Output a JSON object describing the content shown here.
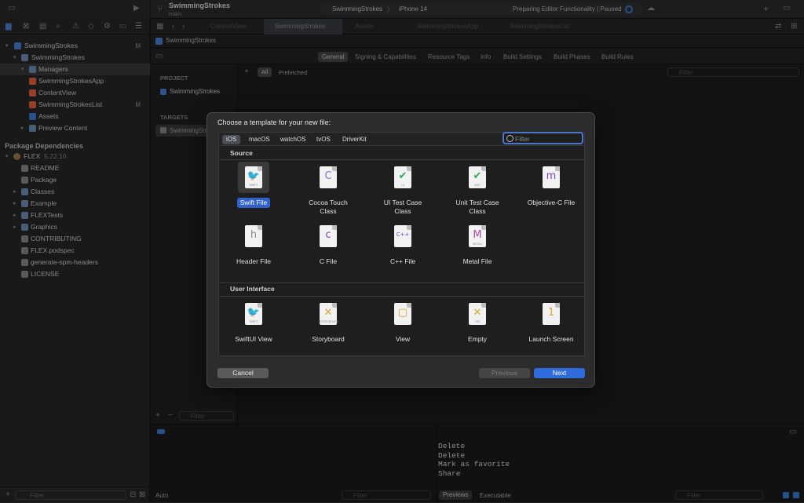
{
  "project_header": {
    "name": "SwimmingStrokes",
    "branch": "main"
  },
  "scheme": {
    "target": "SwimmingStrokes",
    "device": "iPhone 14",
    "status": "Preparing Editor Functionality | Paused"
  },
  "sidebar": {
    "items": [
      {
        "label": "SwimmingStrokes",
        "badge": "M"
      },
      {
        "label": "SwimmingStrokes",
        "badge": ""
      },
      {
        "label": "Managers",
        "badge": ""
      },
      {
        "label": "SwimmingStrokesApp",
        "badge": ""
      },
      {
        "label": "ContentView",
        "badge": ""
      },
      {
        "label": "SwimmingStrokesList",
        "badge": "M"
      },
      {
        "label": "Assets",
        "badge": ""
      },
      {
        "label": "Preview Content",
        "badge": ""
      }
    ],
    "package_section": "Package Dependencies",
    "flex": {
      "name": "FLEX",
      "version": "5.22.10"
    },
    "package_items": [
      "README",
      "Package",
      "Classes",
      "Example",
      "FLEXTests",
      "Graphics",
      "CONTRIBUTING",
      "FLEX.podspec",
      "generate-spm-headers",
      "LICENSE"
    ],
    "filter_placeholder": "Filter"
  },
  "tabs": [
    "ContentView",
    "SwimmingStrokes",
    "Assets",
    "SwimmingStrokesApp",
    "SwimmingStrokesList"
  ],
  "breadcrumb": "SwimmingStrokes",
  "editor_tabs": [
    "General",
    "Signing & Capabilities",
    "Resource Tags",
    "Info",
    "Build Settings",
    "Build Phases",
    "Build Rules"
  ],
  "filter_bar": {
    "all": "All",
    "prefetched": "Prefetched",
    "filter_placeholder": "Filter"
  },
  "project_pane": {
    "project_label": "PROJECT",
    "project": "SwimmingStrokes",
    "targets_label": "TARGETS",
    "target": "SwimmingStr",
    "filter_placeholder": "Filter"
  },
  "console_lines": [
    "Delete",
    "Delete",
    "Mark as favorite",
    "Share"
  ],
  "bottom_bar": {
    "auto": "Auto",
    "filter_placeholder": "Filter",
    "previews": "Previews",
    "executable": "Executable",
    "filter2_placeholder": "Filter"
  },
  "dialog": {
    "title": "Choose a template for your new file:",
    "platforms": [
      "iOS",
      "macOS",
      "watchOS",
      "tvOS",
      "DriverKit"
    ],
    "filter_placeholder": "Filter",
    "source_title": "Source",
    "source_items": [
      {
        "name": "Swift File",
        "name2": "",
        "icon": "swift-icon",
        "glyph": "🐦",
        "color": "#f05138",
        "sub": "SWIFT"
      },
      {
        "name": "Cocoa Touch",
        "name2": "Class",
        "icon": "cocoa-class-icon",
        "glyph": "C",
        "color": "#8a6fc5",
        "sub": ""
      },
      {
        "name": "UI Test Case",
        "name2": "Class",
        "icon": "ui-test-icon",
        "glyph": "✔",
        "color": "#2fa84f",
        "sub": "UI"
      },
      {
        "name": "Unit Test Case",
        "name2": "Class",
        "icon": "unit-test-icon",
        "glyph": "✔",
        "color": "#2fa84f",
        "sub": "UNIT"
      },
      {
        "name": "Objective-C File",
        "name2": "",
        "icon": "objc-icon",
        "glyph": "m",
        "color": "#7b45c8",
        "sub": ""
      },
      {
        "name": "Header File",
        "name2": "",
        "icon": "header-icon",
        "glyph": "h",
        "color": "#8a8a8a",
        "sub": ""
      },
      {
        "name": "C File",
        "name2": "",
        "icon": "c-file-icon",
        "glyph": "c",
        "color": "#7b45c8",
        "sub": ""
      },
      {
        "name": "C++ File",
        "name2": "",
        "icon": "cpp-file-icon",
        "glyph": "C++",
        "color": "#7b45c8",
        "sub": ""
      },
      {
        "name": "Metal File",
        "name2": "",
        "icon": "metal-icon",
        "glyph": "M",
        "color": "#b04a9a",
        "sub": "METAL"
      }
    ],
    "ui_title": "User Interface",
    "ui_items": [
      {
        "name": "SwiftUI View",
        "icon": "swiftui-icon",
        "glyph": "🐦",
        "color": "#f05138",
        "sub": "SWIFT"
      },
      {
        "name": "Storyboard",
        "icon": "storyboard-icon",
        "glyph": "✕",
        "color": "#e0a32c",
        "sub": "STORYBOARD"
      },
      {
        "name": "View",
        "icon": "view-icon",
        "glyph": "▢",
        "color": "#e0a32c",
        "sub": ""
      },
      {
        "name": "Empty",
        "icon": "empty-icon",
        "glyph": "✕",
        "color": "#e0a32c",
        "sub": "XIB"
      },
      {
        "name": "Launch Screen",
        "icon": "launch-screen-icon",
        "glyph": "1",
        "color": "#e0a32c",
        "sub": ""
      }
    ],
    "cancel": "Cancel",
    "previous": "Previous",
    "next": "Next"
  }
}
